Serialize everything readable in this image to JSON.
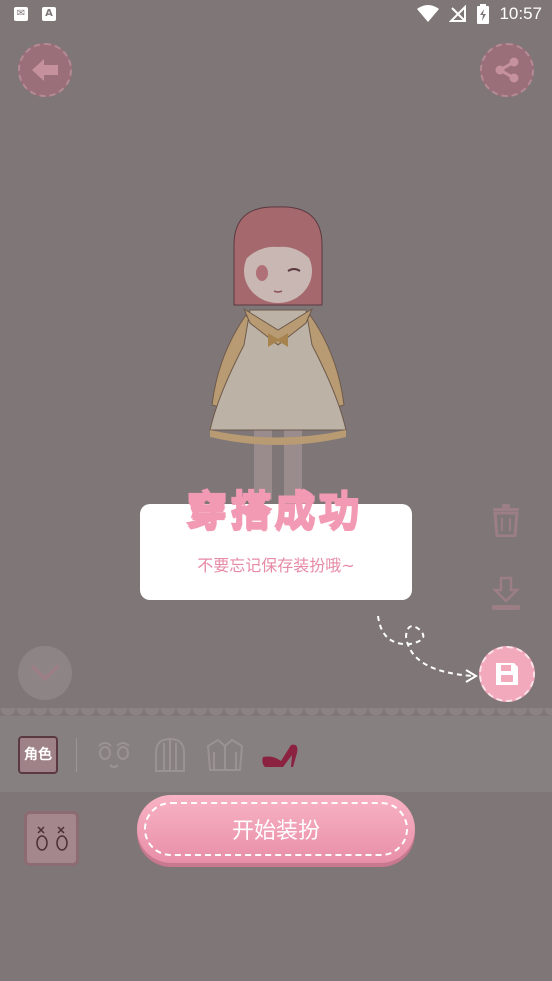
{
  "status_bar": {
    "time": "10:57",
    "left_icons": [
      "mail-icon",
      "font-icon"
    ],
    "right_icons": [
      "wifi-icon",
      "no-signal-icon",
      "battery-charging-icon"
    ]
  },
  "top_buttons": {
    "back": "arrow-left-icon",
    "share": "share-icon"
  },
  "dialog": {
    "title": "穿搭成功",
    "message": "不要忘记保存装扮哦~"
  },
  "side_tools": [
    "trash-icon",
    "download-icon",
    "save-icon"
  ],
  "tabs": {
    "role_label": "角色",
    "items": [
      "face-icon",
      "hair-icon",
      "jacket-icon",
      "high-heel-icon"
    ]
  },
  "primary_action": {
    "label": "开始装扮"
  },
  "colors": {
    "overlay": "#7f7677",
    "accent_pink": "#f29ab3",
    "dialog_bg": "#ffffff"
  }
}
